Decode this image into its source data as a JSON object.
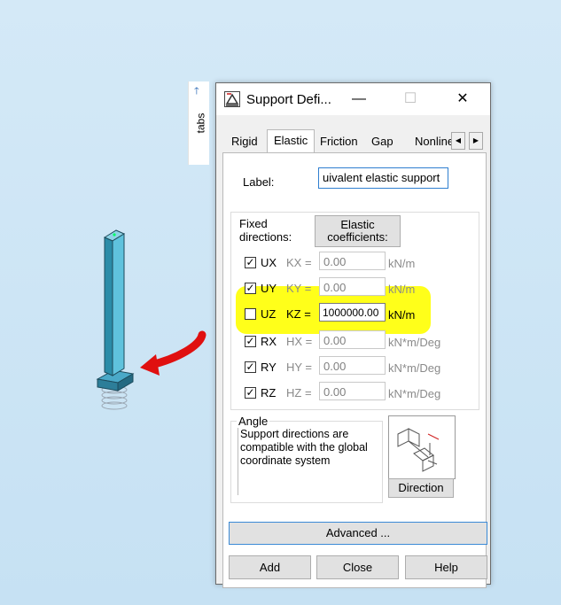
{
  "tabs_strip": {
    "label": "tabs"
  },
  "dialog": {
    "title": "Support Defi...",
    "minimize": "—",
    "maximize": "☐",
    "close": "✕",
    "tabs": [
      "Rigid",
      "Elastic",
      "Friction",
      "Gap",
      "Nonline"
    ],
    "active_tab": "Elastic",
    "label_caption": "Label:",
    "label_value": "uivalent elastic support",
    "fixed_directions": "Fixed directions:",
    "elastic_coeff_button": "Elastic coefficients:",
    "rows": [
      {
        "dir": "UX",
        "checked": true,
        "coef": "KX =",
        "value": "0.00",
        "unit": "kN/m",
        "enabled": false
      },
      {
        "dir": "UY",
        "checked": true,
        "coef": "KY =",
        "value": "0.00",
        "unit": "kN/m",
        "enabled": false
      },
      {
        "dir": "UZ",
        "checked": false,
        "coef": "KZ =",
        "value": "1000000.00",
        "unit": "kN/m",
        "enabled": true
      },
      {
        "dir": "RX",
        "checked": true,
        "coef": "HX =",
        "value": "0.00",
        "unit": "kN*m/Deg",
        "enabled": false
      },
      {
        "dir": "RY",
        "checked": true,
        "coef": "HY =",
        "value": "0.00",
        "unit": "kN*m/Deg",
        "enabled": false
      },
      {
        "dir": "RZ",
        "checked": true,
        "coef": "HZ =",
        "value": "0.00",
        "unit": "kN*m/Deg",
        "enabled": false
      }
    ],
    "angle_caption": "Angle",
    "angle_text": "Support directions are compatible with the global coordinate system",
    "direction_button": "Direction",
    "advanced_button": "Advanced ...",
    "add_button": "Add",
    "close_button": "Close",
    "help_button": "Help",
    "highlight_color": "#ffff1a",
    "arrow_color": "#e01010"
  }
}
